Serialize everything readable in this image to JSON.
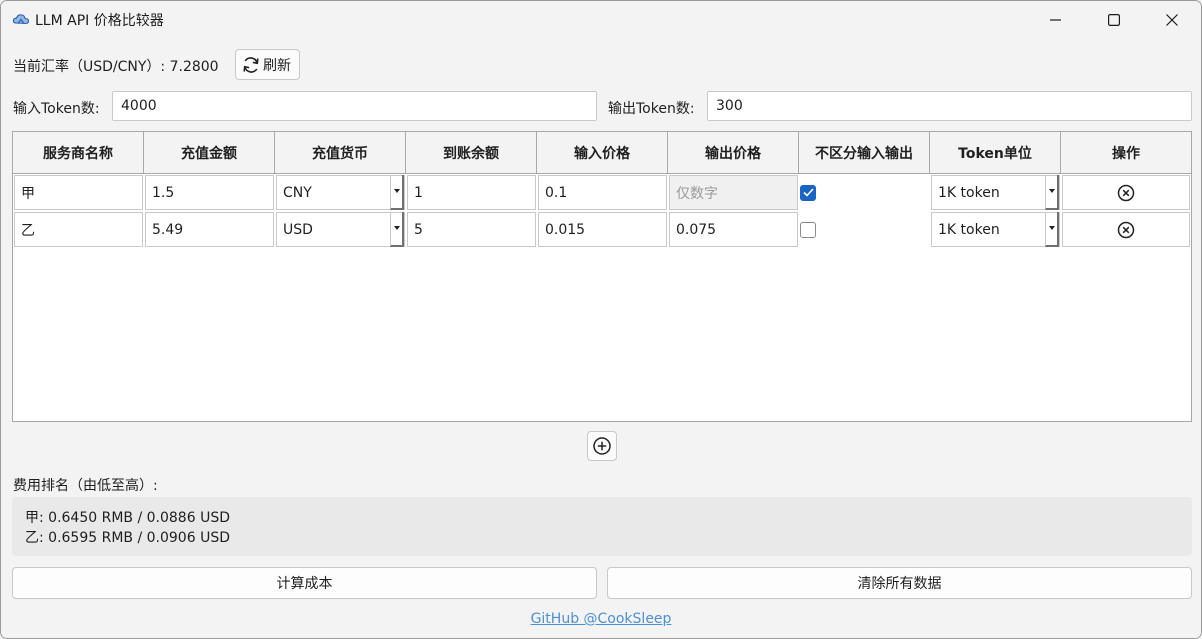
{
  "window": {
    "title": "LLM API 价格比较器",
    "icon": "cloud-app-icon"
  },
  "toolbar": {
    "rate_label": "当前汇率（USD/CNY）: 7.2800",
    "refresh_label": "刷新"
  },
  "tokens": {
    "input_label": "输入Token数:",
    "input_value": "4000",
    "output_label": "输出Token数:",
    "output_value": "300"
  },
  "table": {
    "headers": [
      "服务商名称",
      "充值金额",
      "充值货币",
      "到账余额",
      "输入价格",
      "输出价格",
      "不区分输入输出",
      "Token单位",
      "操作"
    ],
    "rows": [
      {
        "name": "甲",
        "amount": "1.5",
        "currency": "CNY",
        "balance": "1",
        "input_price": "0.1",
        "output_price": "",
        "output_placeholder": "仅数字",
        "unified": true,
        "unit": "1K token"
      },
      {
        "name": "乙",
        "amount": "5.49",
        "currency": "USD",
        "balance": "5",
        "input_price": "0.015",
        "output_price": "0.075",
        "output_placeholder": "",
        "unified": false,
        "unit": "1K token"
      }
    ]
  },
  "ranking": {
    "label": "费用排名（由低至高）:",
    "lines": [
      "甲: 0.6450 RMB / 0.0886 USD",
      "乙: 0.6595 RMB / 0.0906 USD"
    ]
  },
  "actions": {
    "calculate_label": "计算成本",
    "clear_label": "清除所有数据"
  },
  "footer": {
    "link_text": "GitHub @CookSleep"
  },
  "colors": {
    "accent": "#1a64c8",
    "link": "#4a90d9"
  }
}
